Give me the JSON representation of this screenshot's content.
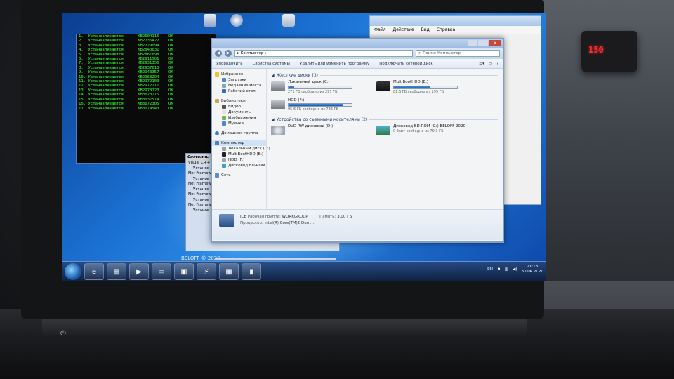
{
  "clock_display": "150",
  "cmd": {
    "lines": [
      "1.  Устанавливается      KB2604115    OK",
      "2.  Устанавливается      KB2736422    OK",
      "3.  Устанавливается      KB2729094    OK",
      "4.  Устанавливается      KB2840631    OK",
      "5.  Устанавливается      KB2861698    OK",
      "6.  Устанавливается      KB2911501    OK",
      "7.  Устанавливается      KB2931356    OK",
      "8.  Устанавливается      KB2937610    OK",
      "9.  Устанавливается      KB2943357    OK",
      "10. Устанавливается      KB2968294    OK",
      "11. Устанавливается      KB2972100    OK",
      "12. Устанавливается      KB2972211    OK",
      "13. Устанавливается      KB2978120    OK",
      "14. Устанавливается      KB3023215    OK",
      "15. Устанавливается      KB3037574    OK",
      "16. Устанавливается      KB3072305    OK",
      "17. Устанавливается      KB3074543    OK"
    ]
  },
  "win2": {
    "menu": [
      "Файл",
      "Действие",
      "Вид",
      "Справка"
    ]
  },
  "installer": {
    "title": "Системны",
    "rows": [
      "Visual C++",
      "Установ",
      "Net Framew",
      "Установ",
      "Net Framew",
      "Установ",
      "Net Framew",
      "Установ",
      "Net Framew",
      "Установ"
    ]
  },
  "beloff": "BELOFF © 2020",
  "explorer": {
    "address": "Компьютер",
    "search_placeholder": "Поиск: Компьютер",
    "toolbar": [
      "Упорядочить",
      "Свойства системы",
      "Удалить или изменить программу",
      "Подключить сетевой диск"
    ],
    "nav": {
      "favorites": "Избранное",
      "fav_items": [
        "Загрузки",
        "Недавние места",
        "Рабочий стол"
      ],
      "libraries": "Библиотеки",
      "lib_items": [
        "Видео",
        "Документы",
        "Изображения",
        "Музыка"
      ],
      "homegroup": "Домашняя группа",
      "computer": "Компьютер",
      "comp_items": [
        "Локальный диск (C:)",
        "MultiBootHDD (E:)",
        "HDD (F:)",
        "Дисковод BD-ROM"
      ],
      "network": "Сеть"
    },
    "hard_disks_title": "Жесткие диски (3)",
    "hard_disks": [
      {
        "name": "Локальный диск (C:)",
        "free": "271 ГБ свободно из 297 ГБ",
        "used": 0.09
      },
      {
        "name": "MultiBootHDD (E:)",
        "free": "81,6 ГБ свободно из 195 ГБ",
        "used": 0.58
      },
      {
        "name": "HDD (F:)",
        "free": "95,6 ГБ свободно из 736 ГБ",
        "used": 0.87
      }
    ],
    "removable_title": "Устройства со съемными носителями (2)",
    "removable": [
      {
        "name": "DVD RW дисковод (D:)",
        "free": ""
      },
      {
        "name": "Дисковод BD-ROM (G:) BELOFF 2020",
        "free": "0 байт свободно из 70,3 ГБ"
      }
    ],
    "details": {
      "pcname": "ICE",
      "workgroup_label": "Рабочая группа:",
      "workgroup": "WORKGROUP",
      "memory_label": "Память:",
      "memory": "3,00 ГБ",
      "cpu_label": "Процессор:",
      "cpu": "Intel(R) Core(TM)2 Duo ..."
    }
  },
  "taskbar": {
    "lang": "RU",
    "time": "21:18",
    "date": "30.06.2020"
  }
}
